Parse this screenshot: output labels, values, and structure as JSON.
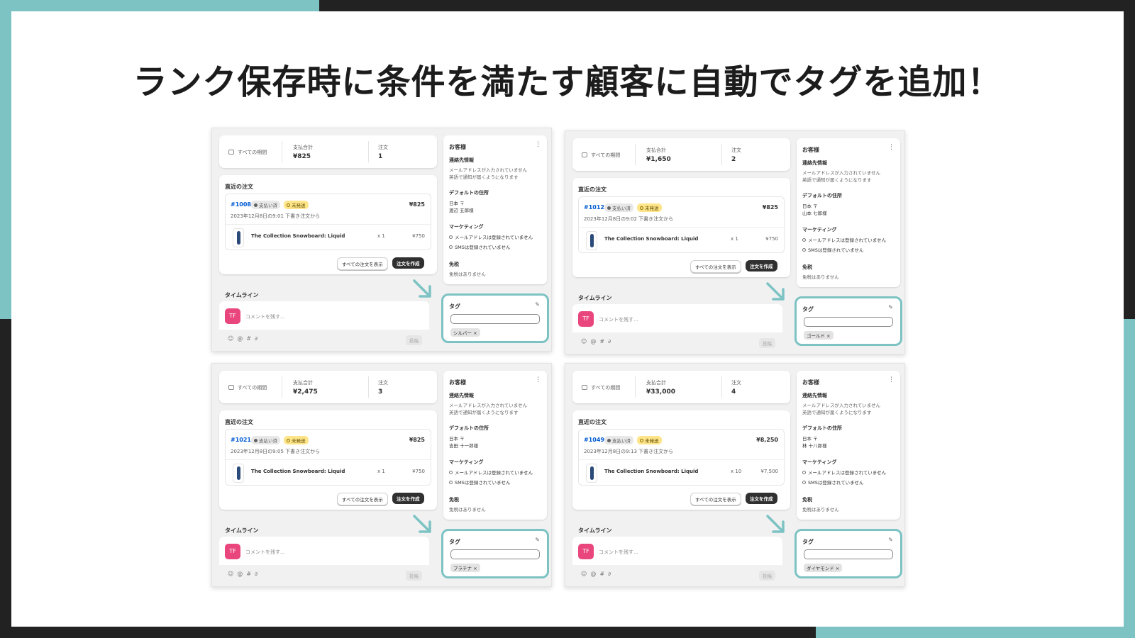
{
  "slide": {
    "title": "ランク保存時に条件を満たす顧客に自動でタグを追加！",
    "accent_color": "#7dc3c4",
    "background_color": "#222222"
  },
  "labels": {
    "period": "すべての期間",
    "spend_label": "支払合計",
    "orders_label": "注文",
    "recent_orders": "直近の注文",
    "badge_paid": "支払い済",
    "badge_unfulfilled": "未発送",
    "product_name": "The Collection Snowboard: Liquid",
    "view_all_orders": "すべての注文を表示",
    "create_order": "注文を作成",
    "timeline": "タイムライン",
    "avatar_initials": "TF",
    "comment_placeholder": "コメントを残す...",
    "post": "投稿",
    "customer": "お客様",
    "contact": "連絡先情報",
    "no_email": "メールアドレスが入力されていません",
    "english_notice": "英語で通知が届くようになります",
    "default_address": "デフォルトの住所",
    "country": "日本 〒",
    "marketing": "マーケティング",
    "email_not_subscribed": "メールアドレスは登録されていません",
    "sms_not_subscribed": "SMSは登録されていません",
    "tax": "免税",
    "no_tax_exempt": "免税はありません",
    "tags": "タグ"
  },
  "panels": [
    {
      "spend": "¥825",
      "orders": "1",
      "order_no": "#1008",
      "order_total": "¥825",
      "order_date": "2023年12月8日の9:01 下書き注文から",
      "qty": "x 1",
      "line_price": "¥750",
      "customer_name": "渡辺 五郎様",
      "tag": "シルバー ×"
    },
    {
      "spend": "¥1,650",
      "orders": "2",
      "order_no": "#1012",
      "order_total": "¥825",
      "order_date": "2023年12月8日の9:02 下書き注文から",
      "qty": "x 1",
      "line_price": "¥750",
      "customer_name": "山本 七郎様",
      "tag": "ゴールド ×"
    },
    {
      "spend": "¥2,475",
      "orders": "3",
      "order_no": "#1021",
      "order_total": "¥825",
      "order_date": "2023年12月8日の9:05 下書き注文から",
      "qty": "x 1",
      "line_price": "¥750",
      "customer_name": "吉田 十一郎様",
      "tag": "プラチナ ×"
    },
    {
      "spend": "¥33,000",
      "orders": "4",
      "order_no": "#1049",
      "order_total": "¥8,250",
      "order_date": "2023年12月8日の9:13 下書き注文から",
      "qty": "x 10",
      "line_price": "¥7,500",
      "customer_name": "林 十八郎様",
      "tag": "ダイヤモンド ×"
    }
  ],
  "icons": [
    "calendar-icon",
    "more-icon",
    "pencil-icon",
    "emoji-icon",
    "mention-icon",
    "hashtag-icon",
    "attachment-icon",
    "arrow-down-right-icon"
  ]
}
